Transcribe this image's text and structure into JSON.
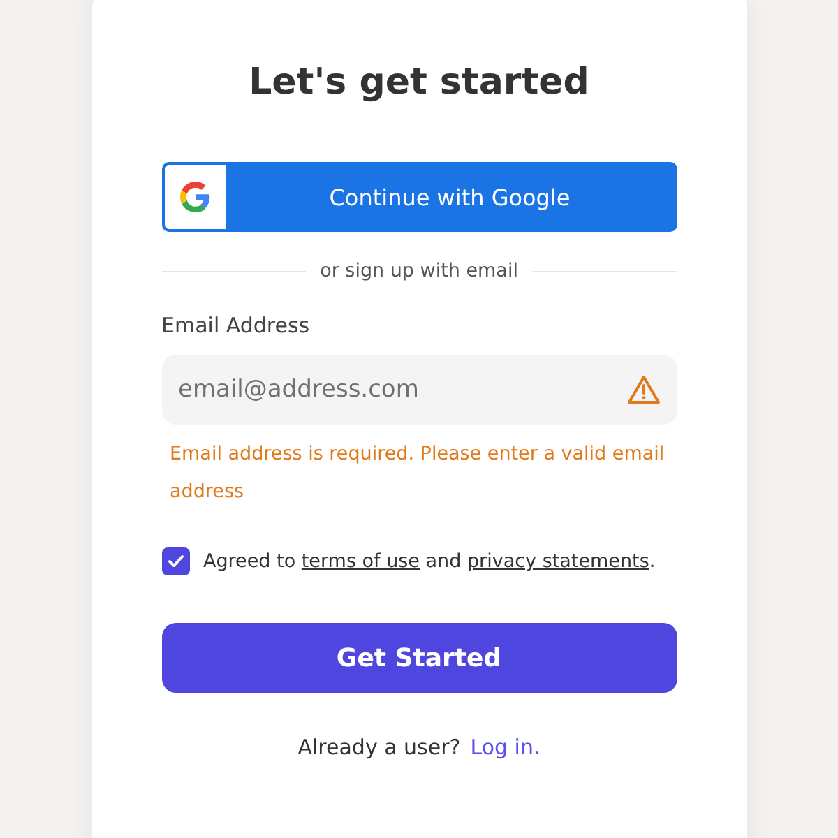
{
  "title": "Let's get started",
  "google_button": {
    "label": "Continue with Google"
  },
  "divider_text": "or sign up with email",
  "email": {
    "label": "Email Address",
    "placeholder": "email@address.com",
    "error": true,
    "error_message": "Email address is required. Please enter a valid email address"
  },
  "agreement": {
    "checked": true,
    "parts": [
      {
        "kind": "text",
        "text": "Agreed to"
      },
      {
        "kind": "link",
        "text": "terms of use"
      },
      {
        "kind": "text",
        "text": "and"
      },
      {
        "kind": "link",
        "text": "privacy statements"
      },
      {
        "kind": "end",
        "text": "."
      }
    ]
  },
  "submit_button": {
    "label": "Get Started"
  },
  "login": {
    "prompt": "Already a user?",
    "link": "Log in."
  }
}
